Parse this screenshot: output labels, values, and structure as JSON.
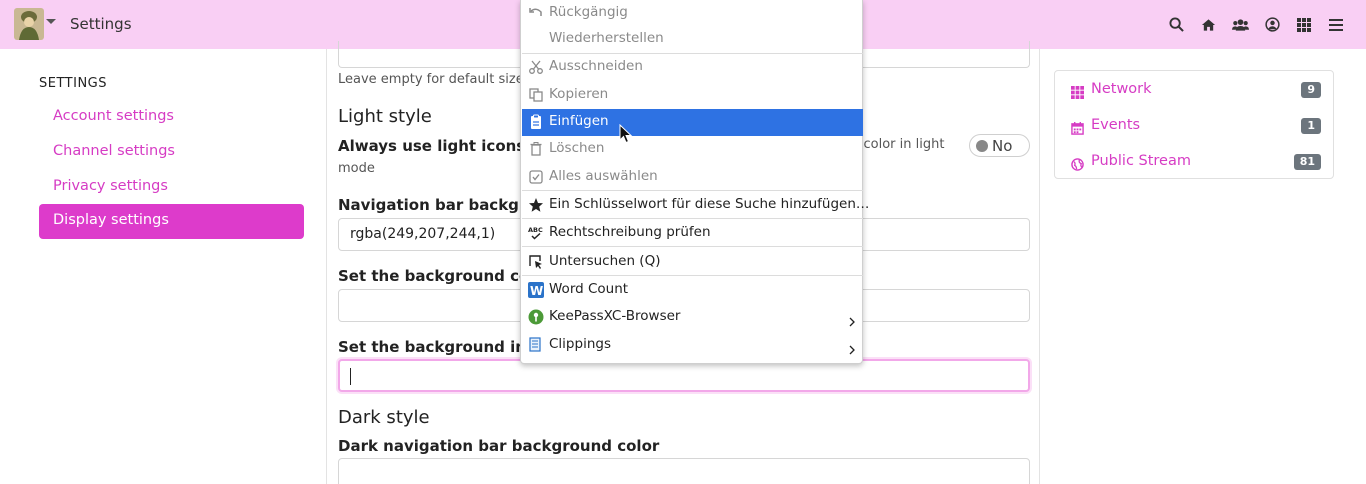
{
  "navbar": {
    "title": "Settings",
    "icons": [
      "search-icon",
      "home-icon",
      "users-icon",
      "user-circle-icon",
      "apps-grid-icon",
      "menu-icon"
    ]
  },
  "sidebar": {
    "heading": "SETTINGS",
    "items": [
      {
        "label": "Account settings"
      },
      {
        "label": "Channel settings"
      },
      {
        "label": "Privacy settings"
      },
      {
        "label": "Display settings",
        "active": true
      }
    ]
  },
  "main": {
    "help_default_size": "Leave empty for default size",
    "light_style_heading": "Light style",
    "light_icons_label": "Always use light icons fo",
    "light_icons_help": "r color in light",
    "light_icons_help_cont": "mode",
    "light_icons_toggle": "No",
    "nav_bg_label": "Navigation bar backgro",
    "nav_bg_value": "rgba(249,207,244,1)",
    "bg_color_label": "Set the background colo",
    "bg_image_label": "Set the background ima",
    "dark_style_heading": "Dark style",
    "dark_nav_bg_label": "Dark navigation bar background color"
  },
  "right_sidebar": {
    "items": [
      {
        "label": "Network",
        "count": "9",
        "icon": "grid-icon"
      },
      {
        "label": "Events",
        "count": "1",
        "icon": "calendar-icon"
      },
      {
        "label": "Public Stream",
        "count": "81",
        "icon": "globe-icon"
      }
    ]
  },
  "context_menu": {
    "items": [
      {
        "label": "Rückgängig",
        "disabled": true,
        "icon": "undo-icon"
      },
      {
        "label": "Wiederherstellen",
        "disabled": true,
        "icon": ""
      },
      {
        "label": "Ausschneiden",
        "disabled": true,
        "icon": "scissors-icon"
      },
      {
        "label": "Kopieren",
        "disabled": true,
        "icon": "copy-icon"
      },
      {
        "label": "Einfügen",
        "highlighted": true,
        "icon": "clipboard-icon"
      },
      {
        "label": "Löschen",
        "disabled": true,
        "icon": "trash-icon"
      },
      {
        "label": "Alles auswählen",
        "disabled": true,
        "icon": "select-all-icon"
      },
      {
        "label": "Ein Schlüsselwort für diese Suche hinzufügen…",
        "icon": "star-icon"
      },
      {
        "label": "Rechtschreibung prüfen",
        "icon": "spellcheck-icon"
      },
      {
        "label": "Untersuchen (Q)",
        "icon": "inspect-icon"
      },
      {
        "label": "Word Count",
        "icon": "word-count-icon"
      },
      {
        "label": "KeePassXC-Browser",
        "icon": "keepassxc-icon",
        "submenu": true
      },
      {
        "label": "Clippings",
        "icon": "clippings-icon",
        "submenu": true
      }
    ]
  },
  "colors": {
    "navbar_bg": "#f9cff4",
    "accent": "#dd3bcb",
    "link": "#d63cc4",
    "menu_highlight": "#2e72e3",
    "badge": "#6c757d"
  }
}
